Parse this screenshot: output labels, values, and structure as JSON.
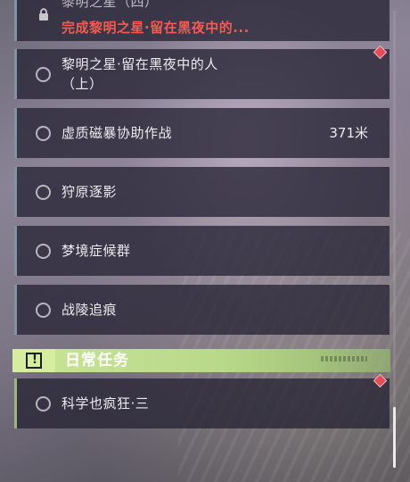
{
  "quests": {
    "top_locked": {
      "title": "黎明之星（四）",
      "requirement": "完成黎明之星·留在黑夜中的..."
    },
    "items": [
      {
        "label_line1": "黎明之星·留在黑夜中的人",
        "label_line2": "（上）"
      },
      {
        "label": "虚质磁暴协助作战",
        "distance": "371米"
      },
      {
        "label": "狩原逐影"
      },
      {
        "label": "梦境症候群"
      },
      {
        "label": "战陵追痕"
      }
    ]
  },
  "daily": {
    "header": "日常任务",
    "items": [
      {
        "label": "科学也疯狂·三"
      }
    ]
  },
  "colors": {
    "panel": "#262434",
    "accent_bar": "#7f93a3",
    "daily_green": "#c9e596",
    "requirement_red": "#f05c52",
    "marker_red": "#e24d5a"
  },
  "icons": [
    "lock-icon",
    "circle-icon",
    "exclamation-icon",
    "diamond-marker-icon"
  ]
}
